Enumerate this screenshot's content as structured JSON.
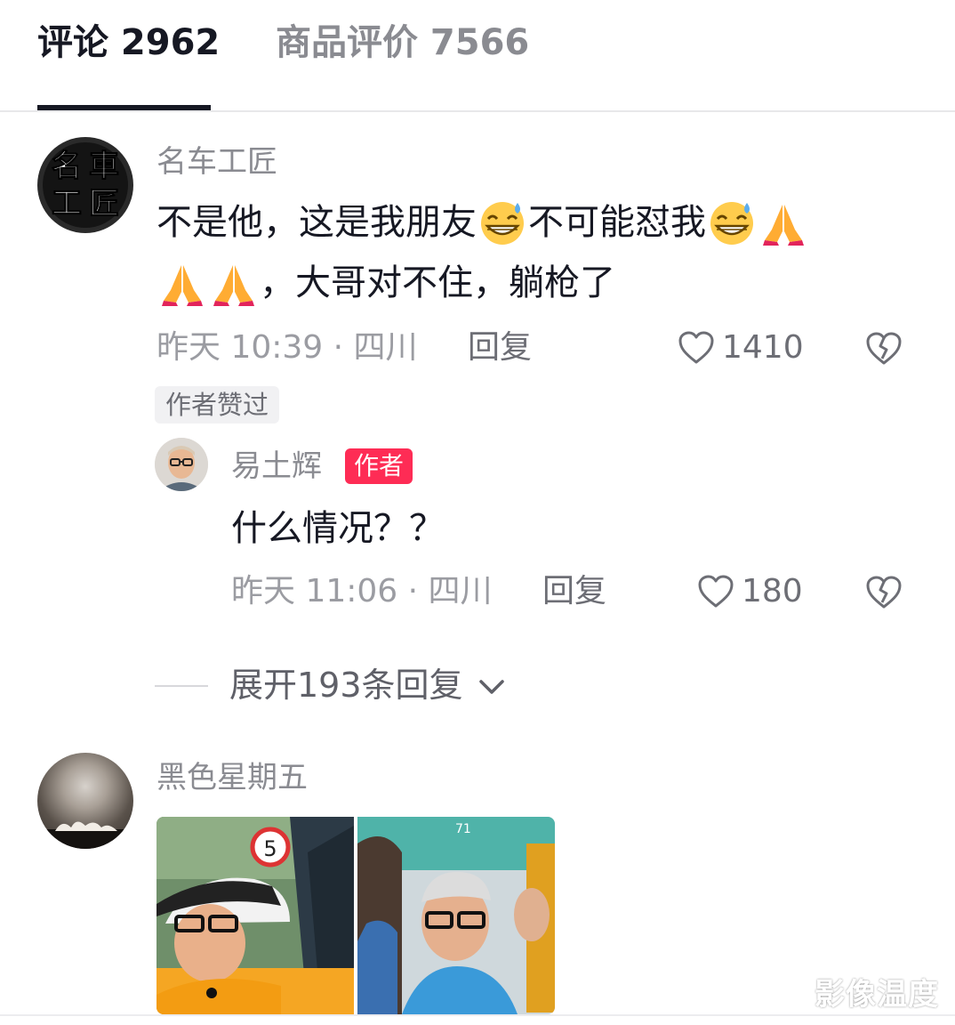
{
  "tabs": {
    "comments": "评论 2962",
    "reviews": "商品评价 7566"
  },
  "comment1": {
    "avatar_text": [
      "名",
      "車",
      "工",
      "匠"
    ],
    "username": "名车工匠",
    "line1_a": "不是他，这是我朋友",
    "line1_b": "不可能怼我",
    "line2": "，大哥对不住，躺枪了",
    "meta": "昨天 10:39 · 四川",
    "reply": "回复",
    "likes": "1410",
    "liked_badge": "作者赞过"
  },
  "reply1": {
    "username": "易土辉",
    "author_tag": "作者",
    "text": "什么情况？？",
    "meta": "昨天 11:06 · 四川",
    "reply": "回复",
    "likes": "180"
  },
  "expand": {
    "label": "展开193条回复"
  },
  "comment2": {
    "username": "黑色星期五"
  },
  "watermark": "影像温度",
  "colors": {
    "accent": "#fe2c55",
    "text_primary": "#161823",
    "text_secondary": "#8a8b91"
  }
}
